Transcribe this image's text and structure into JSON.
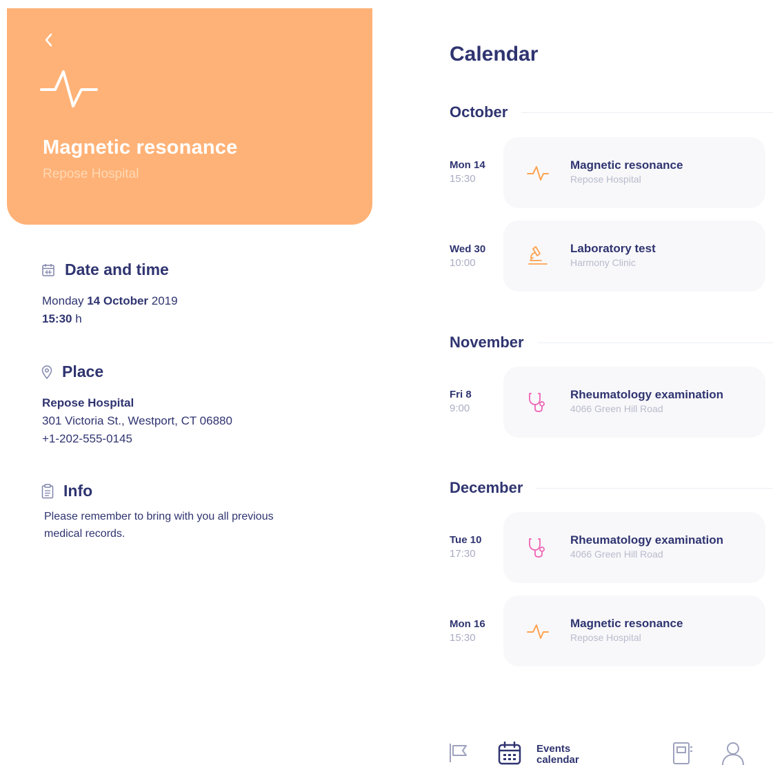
{
  "detail": {
    "title": "Magnetic resonance",
    "subtitle": "Repose Hospital",
    "date_section": {
      "heading": "Date and time",
      "weekday": "Monday",
      "day_month": "14 October",
      "year": "2019",
      "time": "15:30",
      "time_suffix": "h"
    },
    "place_section": {
      "heading": "Place",
      "name": "Repose Hospital",
      "address": "301 Victoria St., Westport, CT 06880",
      "phone": "+1-202-555-0145"
    },
    "info_section": {
      "heading": "Info",
      "text_line1": "Please remember to bring with you all previous",
      "text_line2": "medical records."
    },
    "accent_color": "#ffb277"
  },
  "calendar": {
    "title": "Calendar",
    "months": [
      {
        "name": "October",
        "events": [
          {
            "day": "Mon 14",
            "time": "15:30",
            "title": "Magnetic resonance",
            "place": "Repose Hospital",
            "icon": "pulse-icon"
          },
          {
            "day": "Wed 30",
            "time": "10:00",
            "title": "Laboratory test",
            "place": "Harmony Clinic",
            "icon": "microscope-icon"
          }
        ]
      },
      {
        "name": "November",
        "events": [
          {
            "day": "Fri 8",
            "time": "9:00",
            "title": "Rheumatology examination",
            "place": "4066 Green Hill Road",
            "icon": "stethoscope-icon"
          }
        ]
      },
      {
        "name": "December",
        "events": [
          {
            "day": "Tue 10",
            "time": "17:30",
            "title": "Rheumatology examination",
            "place": "4066 Green Hill Road",
            "icon": "stethoscope-icon"
          },
          {
            "day": "Mon 16",
            "time": "15:30",
            "title": "Magnetic resonance",
            "place": "Repose Hospital",
            "icon": "pulse-icon"
          }
        ]
      }
    ]
  },
  "nav": {
    "active_label_line1": "Events",
    "active_label_line2": "calendar",
    "items": [
      "flag-icon",
      "calendar-icon",
      "notebook-icon",
      "user-icon"
    ]
  },
  "colors": {
    "navy": "#2f3470",
    "orange": "#ffb277",
    "pink": "#f06bb8",
    "card_bg": "#f8f8fa"
  }
}
